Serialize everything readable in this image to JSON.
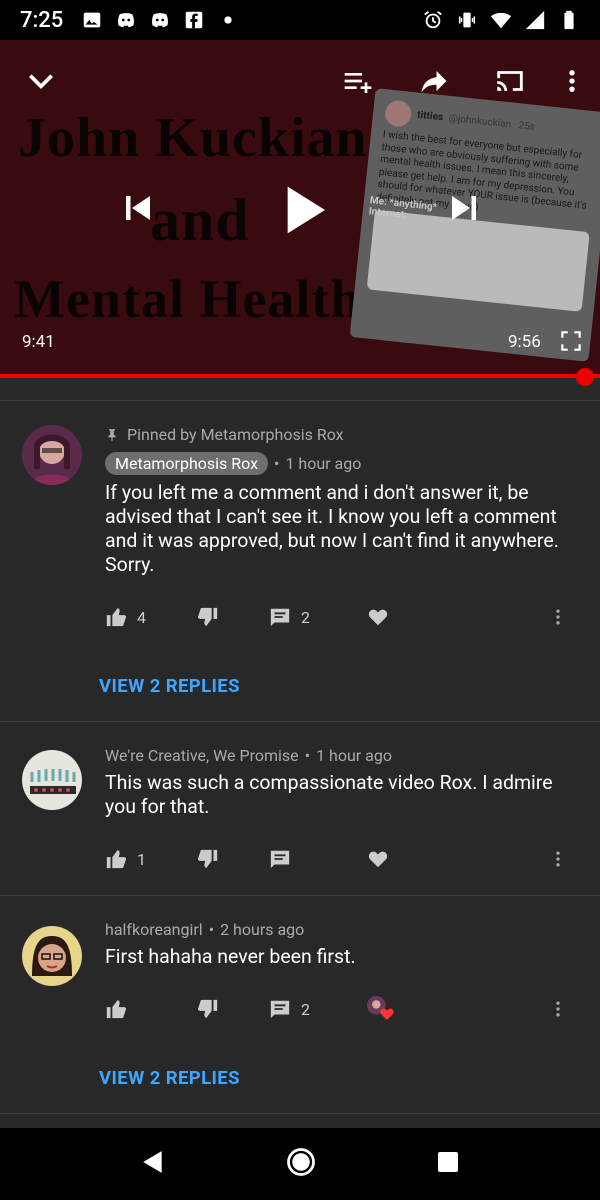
{
  "status_bar": {
    "time": "7:25",
    "left_icons": [
      "image-icon",
      "discord-icon",
      "discord-icon",
      "facebook-icon",
      "dot-icon"
    ],
    "right_icons": [
      "alarm-icon",
      "vibrate-icon",
      "wifi-icon",
      "signal-icon",
      "battery-icon"
    ]
  },
  "video": {
    "title_lines": [
      "John Kuckian",
      "and",
      "Mental Health"
    ],
    "tweet": {
      "name": "titties",
      "handle": "@johnkuckian · 25s",
      "text": "I wish the best for everyone but especially for those who are obviously suffering with some mental health issues. I mean this sincerely, please get help. I am for my depression. You should for whatever YOUR issue is (because it's definitely not my issue)",
      "meme_label_1": "Me: *anything*",
      "meme_label_2": "Internet:"
    },
    "current_time": "9:41",
    "duration": "9:56",
    "progress_fraction": 0.982
  },
  "comments": [
    {
      "pinned_label": "Pinned by Metamorphosis Rox",
      "author": "Metamorphosis Rox",
      "time": "1 hour ago",
      "text": "If you left me a comment and i don't answer it, be advised that I can't see it. I know you left a comment and it was approved, but now I can't find it anywhere. Sorry.",
      "likes": "4",
      "replies_count": "2",
      "view_replies": "VIEW 2 REPLIES"
    },
    {
      "author": "We're Creative, We Promise",
      "time": "1 hour ago",
      "text": "This was such a compassionate video Rox. I admire you for that.",
      "likes": "1"
    },
    {
      "author": "halfkoreangirl",
      "time": "2 hours ago",
      "text": "First hahaha never been first.",
      "replies_count": "2",
      "view_replies": "VIEW 2 REPLIES"
    }
  ],
  "separator": "•",
  "colors": {
    "background": "#282828",
    "accent_blue": "#3ea6ff",
    "progress_red": "#ee0000"
  }
}
